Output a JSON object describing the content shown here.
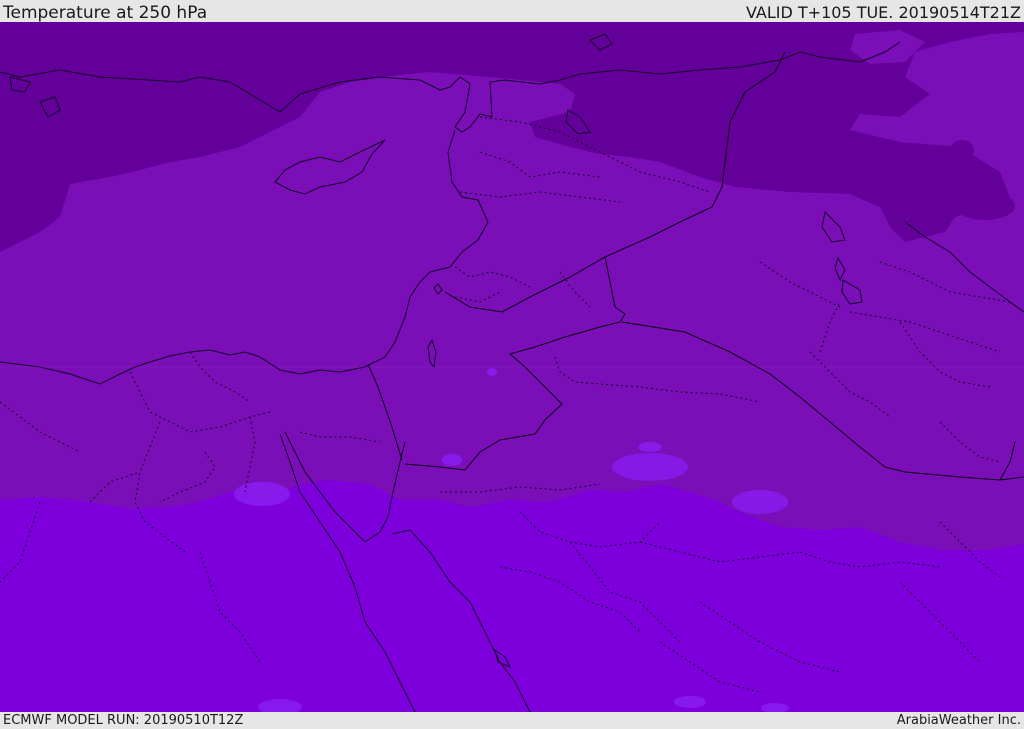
{
  "header": {
    "title": "Temperature at 250 hPa",
    "valid": "VALID T+105 TUE. 20190514T21Z"
  },
  "footer": {
    "model_run": "ECMWF MODEL RUN: 20190510T12Z",
    "credit": "ArabiaWeather Inc."
  },
  "colors": {
    "band_dark": "#64009a",
    "band_mid": "#7a0fb8",
    "band_bright": "#7d00dc",
    "band_brightest": "#8a1cf0",
    "coast": "#14002a",
    "border": "#0a0018"
  }
}
